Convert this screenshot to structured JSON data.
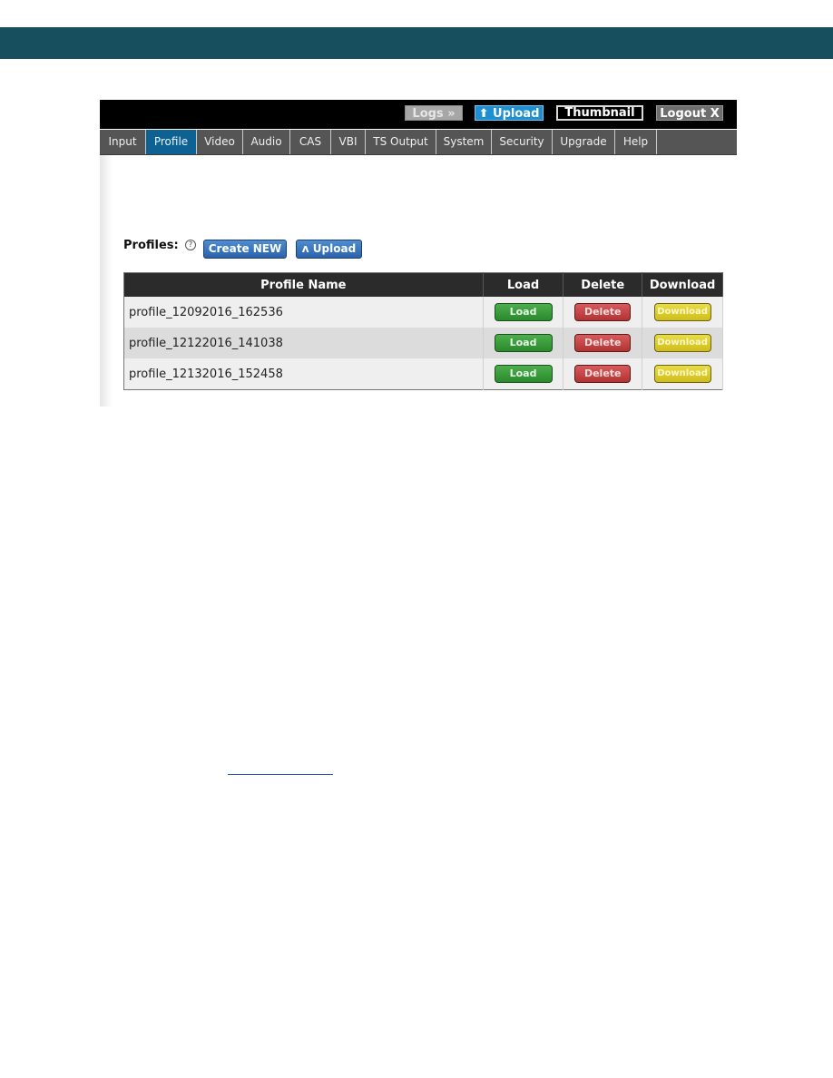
{
  "topbar": {
    "logs_label": "Logs »",
    "upload_label": "⬆ Upload",
    "thumbnail_label": "Thumbnail",
    "logout_label": "Logout X"
  },
  "nav": {
    "active": "Profile",
    "tabs": [
      {
        "label": "Input"
      },
      {
        "label": "Profile"
      },
      {
        "label": "Video"
      },
      {
        "label": "Audio"
      },
      {
        "label": "CAS"
      },
      {
        "label": "VBI"
      },
      {
        "label": "TS Output"
      },
      {
        "label": "System"
      },
      {
        "label": "Security"
      },
      {
        "label": "Upgrade"
      },
      {
        "label": "Help"
      }
    ]
  },
  "profiles": {
    "label": "Profiles:",
    "help_icon": "?",
    "create_label": "Create NEW",
    "upload_label": "ʌ Upload",
    "columns": [
      "Profile Name",
      "Load",
      "Delete",
      "Download"
    ],
    "rows": [
      {
        "name": "profile_12092016_162536",
        "load": "Load",
        "delete": "Delete",
        "download": "Download"
      },
      {
        "name": "profile_12122016_141038",
        "load": "Load",
        "delete": "Delete",
        "download": "Download"
      },
      {
        "name": "profile_12132016_152458",
        "load": "Load",
        "delete": "Delete",
        "download": "Download"
      }
    ]
  },
  "colors": {
    "banner": "#174f5f",
    "active_tab": "#0e6193",
    "load": "#2e8b2e",
    "delete": "#c03c3c",
    "download": "#d9c828"
  }
}
